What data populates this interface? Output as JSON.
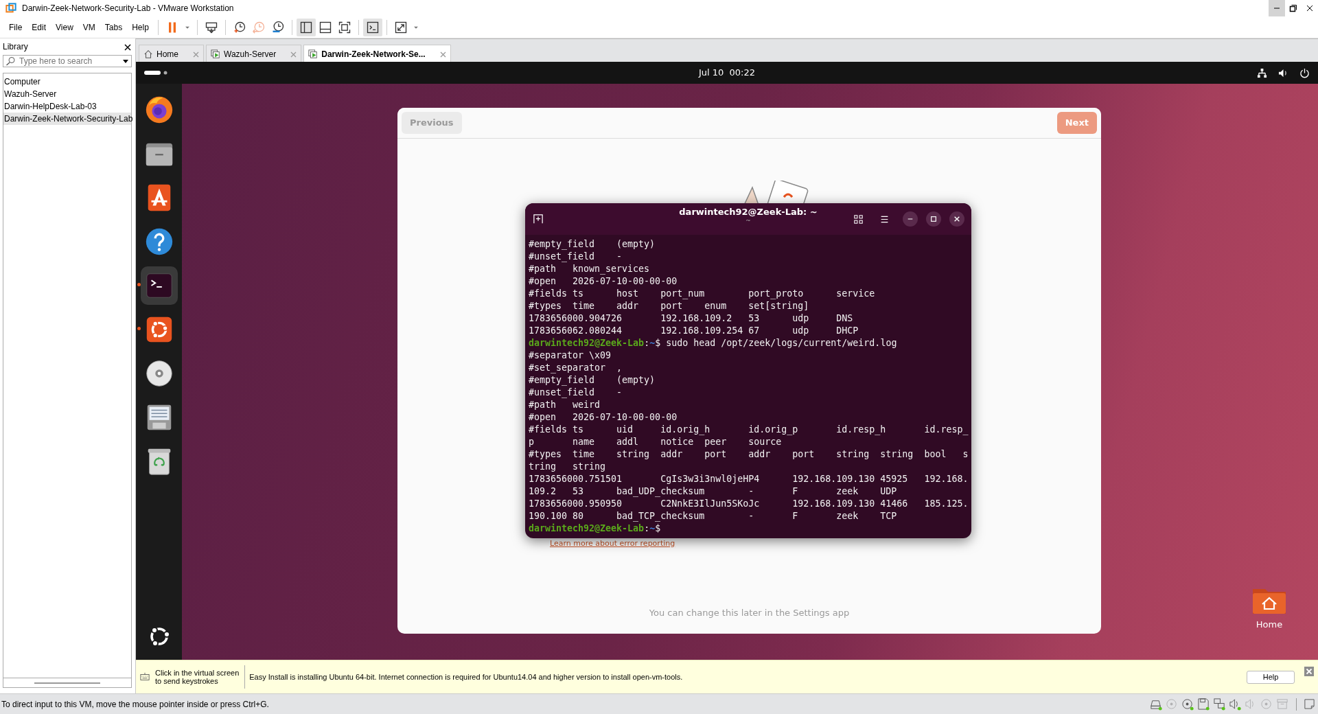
{
  "window": {
    "title": "Darwin-Zeek-Network-Security-Lab - VMware Workstation"
  },
  "menu": [
    "File",
    "Edit",
    "View",
    "VM",
    "Tabs",
    "Help"
  ],
  "toolbar": [
    {
      "kind": "pause",
      "pressed": false,
      "disabled": false
    },
    {
      "kind": "caret",
      "pressed": false,
      "disabled": false
    },
    {
      "kind": "send-keys",
      "pressed": false,
      "disabled": false
    },
    {
      "kind": "snapshot-take",
      "pressed": false,
      "disabled": false
    },
    {
      "kind": "snapshot-revert",
      "pressed": false,
      "disabled": true
    },
    {
      "kind": "snapshot-manager",
      "pressed": false,
      "disabled": false
    },
    {
      "kind": "library",
      "pressed": true,
      "disabled": false
    },
    {
      "kind": "thumbnails",
      "pressed": false,
      "disabled": false
    },
    {
      "kind": "fullscreen",
      "pressed": false,
      "disabled": false
    },
    {
      "kind": "console",
      "pressed": true,
      "disabled": false
    },
    {
      "kind": "stretch",
      "pressed": false,
      "disabled": false
    },
    {
      "kind": "caret",
      "pressed": false,
      "disabled": false
    }
  ],
  "library": {
    "title": "Library",
    "search": {
      "placeholder": "Type here to search"
    },
    "items": [
      {
        "label": "Computer",
        "selected": false
      },
      {
        "label": "Wazuh-Server",
        "selected": false
      },
      {
        "label": "Darwin-HelpDesk-Lab-03",
        "selected": false
      },
      {
        "label": "Darwin-Zeek-Network-Security-Lab",
        "selected": true
      }
    ]
  },
  "tabs": [
    {
      "kind": "home",
      "label": "Home",
      "selected": false
    },
    {
      "kind": "vm",
      "label": "Wazuh-Server",
      "selected": false
    },
    {
      "kind": "vm",
      "label": "Darwin-Zeek-Network-Se...",
      "selected": true
    }
  ],
  "guest": {
    "clock": "Jul 10  00:22",
    "dock": [
      {
        "kind": "firefox",
        "running": false,
        "active": false
      },
      {
        "kind": "files",
        "running": false,
        "active": false
      },
      {
        "kind": "app-center",
        "running": false,
        "active": false
      },
      {
        "kind": "help",
        "running": false,
        "active": false
      },
      {
        "kind": "terminal",
        "running": true,
        "active": true
      },
      {
        "kind": "ubuntu",
        "running": true,
        "active": false
      },
      {
        "kind": "disc",
        "running": false,
        "active": false
      },
      {
        "kind": "document",
        "running": false,
        "active": false
      },
      {
        "kind": "trash",
        "running": false,
        "active": false
      }
    ],
    "dialog": {
      "previous": "Previous",
      "next": "Next",
      "link": "Learn more about error reporting",
      "note": "You can change this later in the Settings app"
    },
    "terminal": {
      "title": "darwintech92@Zeek-Lab: ~",
      "subtitle": "~",
      "lines": [
        {
          "kind": "text",
          "text": "#empty_field    (empty)"
        },
        {
          "kind": "text",
          "text": "#unset_field    -"
        },
        {
          "kind": "text",
          "text": "#path   known_services"
        },
        {
          "kind": "text",
          "text": "#open   2026-07-10-00-00-00"
        },
        {
          "kind": "text",
          "text": "#fields ts      host    port_num        port_proto      service"
        },
        {
          "kind": "text",
          "text": "#types  time    addr    port    enum    set[string]"
        },
        {
          "kind": "text",
          "text": "1783656000.904726       192.168.109.2   53      udp     DNS"
        },
        {
          "kind": "text",
          "text": "1783656062.080244       192.168.109.254 67      udp     DHCP"
        },
        {
          "kind": "prompt",
          "user": "darwintech92@Zeek-Lab",
          "sep": ":",
          "path": "~",
          "command": "$ sudo head /opt/zeek/logs/current/weird.log"
        },
        {
          "kind": "text",
          "text": "#separator \\x09"
        },
        {
          "kind": "text",
          "text": "#set_separator  ,"
        },
        {
          "kind": "text",
          "text": "#empty_field    (empty)"
        },
        {
          "kind": "text",
          "text": "#unset_field    -"
        },
        {
          "kind": "text",
          "text": "#path   weird"
        },
        {
          "kind": "text",
          "text": "#open   2026-07-10-00-00-00"
        },
        {
          "kind": "text",
          "text": "#fields ts      uid     id.orig_h       id.orig_p       id.resp_h       id.resp_"
        },
        {
          "kind": "text",
          "text": "p       name    addl    notice  peer    source"
        },
        {
          "kind": "text",
          "text": "#types  time    string  addr    port    addr    port    string  string  bool   s"
        },
        {
          "kind": "text",
          "text": "tring   string"
        },
        {
          "kind": "text",
          "text": "1783656000.751501       CgIs3w3i3nwl0jeHP4      192.168.109.130 45925   192.168."
        },
        {
          "kind": "text",
          "text": "109.2   53      bad_UDP_checksum        -       F       zeek    UDP"
        },
        {
          "kind": "text",
          "text": "1783656000.950950       C2NnkE3IlJun5SKoJc      192.168.109.130 41466   185.125."
        },
        {
          "kind": "text",
          "text": "190.100 80      bad_TCP_checksum        -       F       zeek    TCP"
        },
        {
          "kind": "prompt",
          "user": "darwintech92@Zeek-Lab",
          "sep": ":",
          "path": "~",
          "command": "$"
        }
      ]
    },
    "desktop_icons": [
      {
        "label": "Home"
      }
    ]
  },
  "info_bar": {
    "hint": "Click in the virtual screen\nto send keystrokes",
    "message": "Easy Install is installing Ubuntu 64-bit. Internet connection is required for Ubuntu14.04 and higher version to install open-vm-tools.",
    "button": "Help"
  },
  "status_bar": {
    "text": "To direct input to this VM, move the mouse pointer inside or press Ctrl+G.",
    "devices": [
      {
        "kind": "hard-disk",
        "connected": true
      },
      {
        "kind": "disc",
        "connected": false
      },
      {
        "kind": "disc",
        "connected": true
      },
      {
        "kind": "floppy",
        "connected": true
      },
      {
        "kind": "network",
        "connected": true
      },
      {
        "kind": "speaker",
        "connected": true
      },
      {
        "kind": "speaker",
        "connected": false
      },
      {
        "kind": "disc",
        "connected": false
      },
      {
        "kind": "archive",
        "connected": false
      }
    ]
  }
}
